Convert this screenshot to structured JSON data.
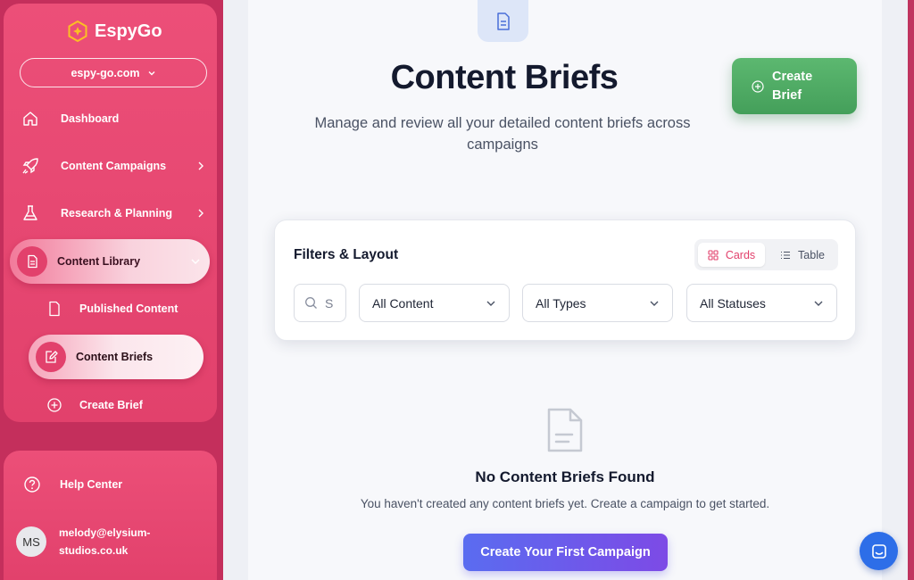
{
  "app": {
    "name": "EspyGo",
    "site": "espy-go.com"
  },
  "sidebar": {
    "items": [
      {
        "label": "Dashboard"
      },
      {
        "label": "Content Campaigns"
      },
      {
        "label": "Research & Planning"
      },
      {
        "label": "Content Library"
      }
    ],
    "sub_items": [
      {
        "label": "Published Content"
      },
      {
        "label": "Content Briefs"
      },
      {
        "label": "Create Brief"
      }
    ],
    "help": "Help Center",
    "user": {
      "initials": "MS",
      "email": "melody@elysium-studios.co.uk"
    }
  },
  "page": {
    "title": "Content Briefs",
    "subtitle": "Manage and review all your detailed content briefs across campaigns",
    "create_button": "Create Brief"
  },
  "filters": {
    "title": "Filters & Layout",
    "view_cards": "Cards",
    "view_table": "Table",
    "active_view": "Cards",
    "search_value": "S",
    "content_filter": "All Content",
    "type_filter": "All Types",
    "status_filter": "All Statuses"
  },
  "empty_state": {
    "title": "No Content Briefs Found",
    "message": "You haven't created any content briefs yet. Create a campaign to get started.",
    "button": "Create Your First Campaign"
  },
  "colors": {
    "brand": "#e2416c",
    "green": "#4caa62",
    "purple": "#6b5aeb",
    "chat": "#2d6ee8"
  }
}
